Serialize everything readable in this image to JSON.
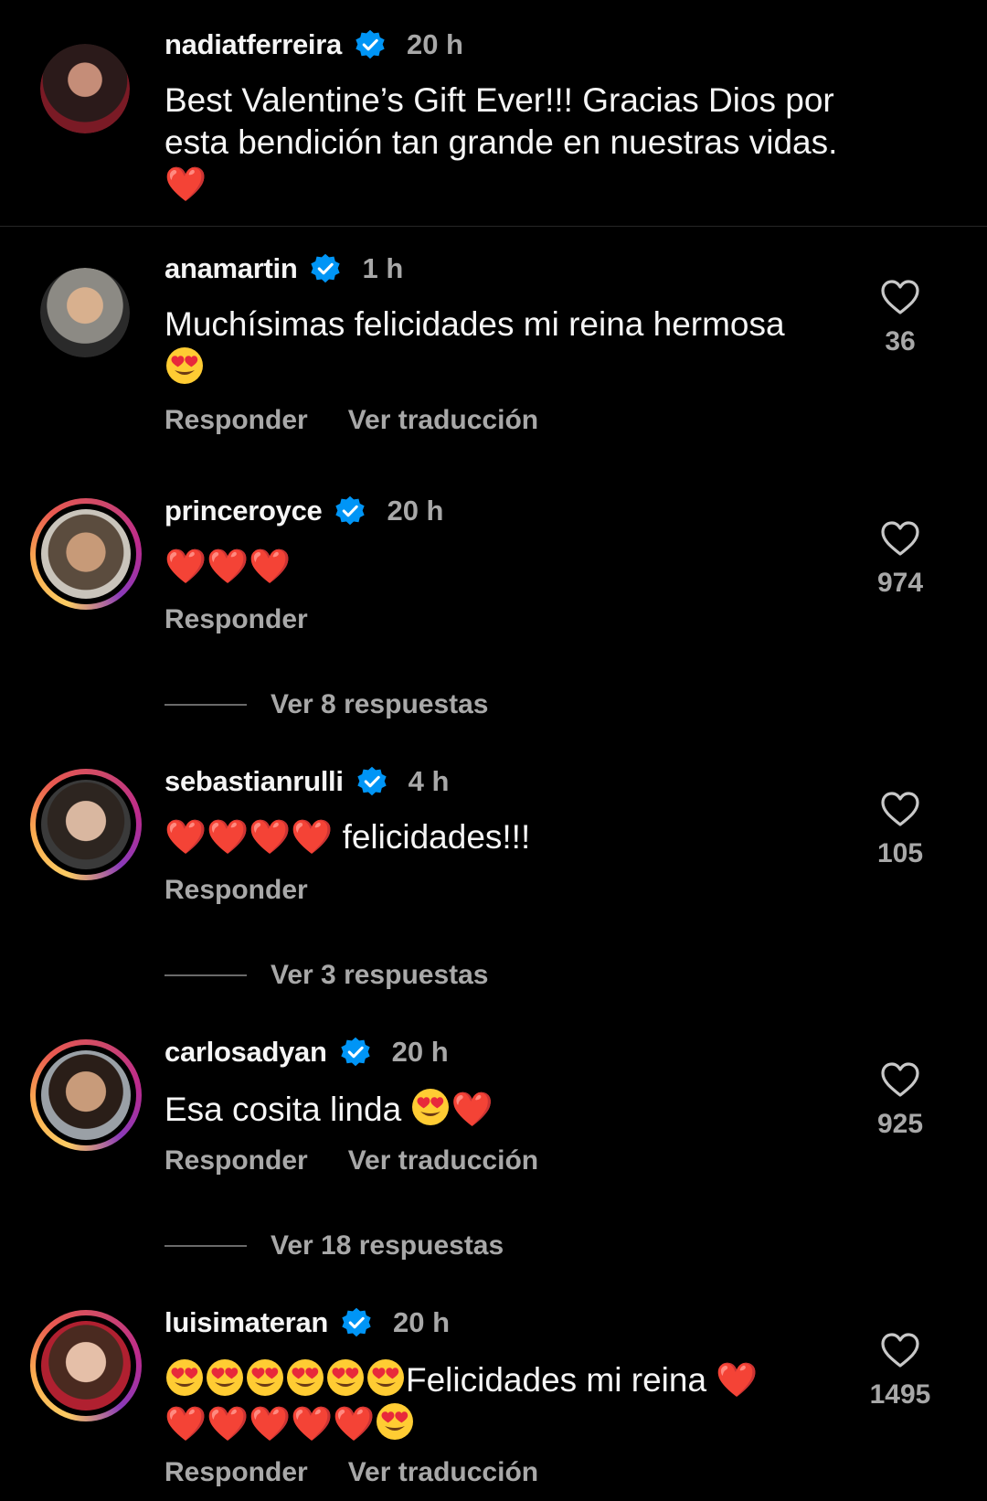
{
  "caption": {
    "username": "nadiatferreira",
    "time": "20 h",
    "text": "Best Valentine’s Gift Ever!!! Gracias Dios por esta bendición tan grande en nuestras vidas.",
    "emoji": "❤️"
  },
  "comments": [
    {
      "username": "anamartin",
      "time": "1 h",
      "text": "Muchísimas felicidades mi reina hermosa",
      "likes": "36",
      "reply_label": "Responder",
      "translate_label": "Ver traducción"
    },
    {
      "username": "princeroyce",
      "time": "20 h",
      "text": "",
      "likes": "974",
      "reply_label": "Responder",
      "view_replies": "Ver 8 respuestas"
    },
    {
      "username": "sebastianrulli",
      "time": "4 h",
      "text": "felicidades!!!",
      "likes": "105",
      "reply_label": "Responder",
      "view_replies": "Ver 3 respuestas"
    },
    {
      "username": "carlosadyan",
      "time": "20 h",
      "text": "Esa cosita linda",
      "likes": "925",
      "reply_label": "Responder",
      "translate_label": "Ver traducción",
      "view_replies": "Ver 18 respuestas"
    },
    {
      "username": "luisimateran",
      "time": "20 h",
      "text": "Felicidades mi reina",
      "likes": "1495",
      "reply_label": "Responder",
      "translate_label": "Ver traducción"
    }
  ],
  "colors": {
    "background": "#000000",
    "verified": "#0095f6",
    "secondary_text": "#a8a8a8"
  }
}
